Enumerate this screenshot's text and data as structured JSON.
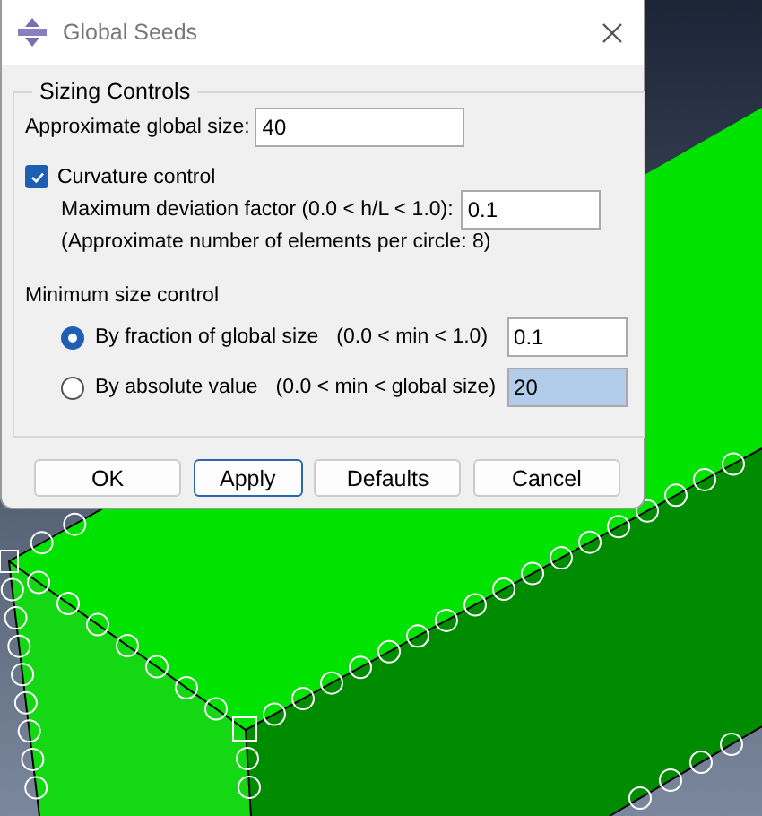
{
  "window": {
    "title": "Global Seeds"
  },
  "sizing_controls": {
    "title": "Sizing Controls",
    "global_size": {
      "label": "Approximate global size:",
      "value": "40"
    },
    "curvature": {
      "label": "Curvature control",
      "checked": true,
      "deviation": {
        "label": "Maximum deviation factor (0.0 < h/L < 1.0):",
        "value": "0.1"
      },
      "note": "(Approximate number of elements per circle: 8)"
    },
    "minimum_size": {
      "title": "Minimum size control",
      "options": [
        {
          "label": "By fraction of global size",
          "range": "(0.0 < min < 1.0)",
          "value": "0.1",
          "selected": true,
          "highlighted": false
        },
        {
          "label": "By absolute value",
          "range": "(0.0 < min < global size)",
          "value": "20",
          "selected": false,
          "highlighted": true
        }
      ]
    }
  },
  "buttons": [
    {
      "label": "OK",
      "default": false
    },
    {
      "label": "Apply",
      "default": true
    },
    {
      "label": "Defaults",
      "default": false
    },
    {
      "label": "Cancel",
      "default": false
    }
  ]
}
